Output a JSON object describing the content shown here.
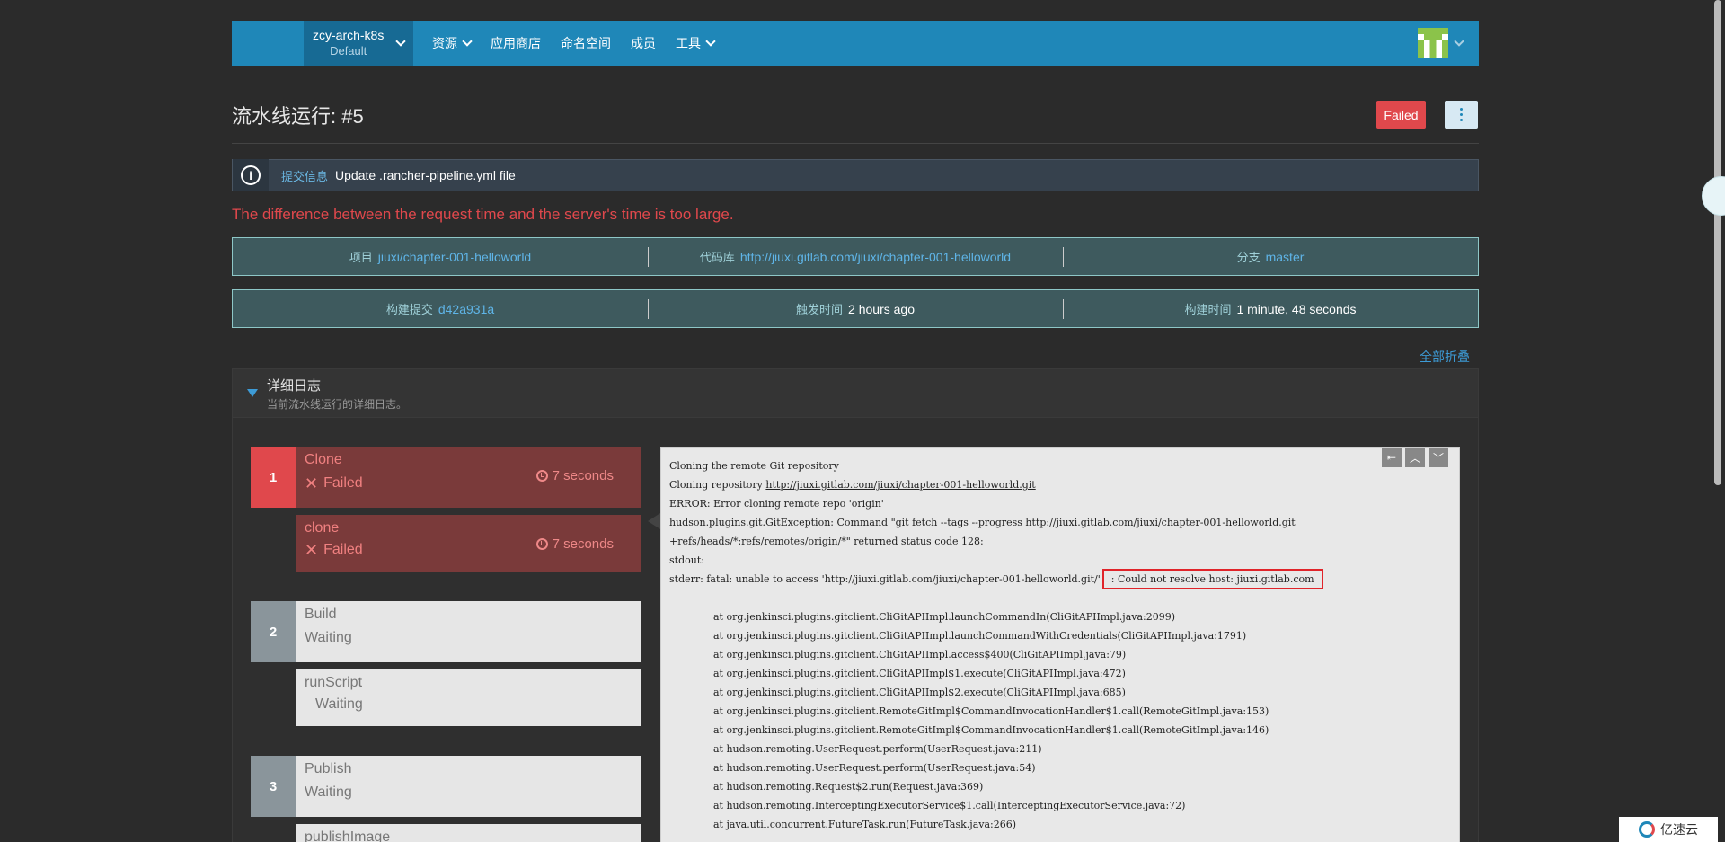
{
  "header": {
    "cluster_name": "zcy-arch-k8s",
    "cluster_sub": "Default",
    "nav": [
      {
        "label": "资源",
        "has_caret": true
      },
      {
        "label": "应用商店",
        "has_caret": false
      },
      {
        "label": "命名空间",
        "has_caret": false
      },
      {
        "label": "成员",
        "has_caret": false
      },
      {
        "label": "工具",
        "has_caret": true
      }
    ]
  },
  "page": {
    "title": "流水线运行: #5",
    "status_badge": "Failed"
  },
  "commit": {
    "label": "提交信息",
    "message": "Update .rancher-pipeline.yml file"
  },
  "error_message": "The difference between the request time and the server's time is too large.",
  "meta_row1": [
    {
      "label": "项目",
      "value": "jiuxi/chapter-001-helloworld",
      "link": true
    },
    {
      "label": "代码库",
      "value": "http://jiuxi.gitlab.com/jiuxi/chapter-001-helloworld",
      "link": true
    },
    {
      "label": "分支",
      "value": "master",
      "link": true
    }
  ],
  "meta_row2": [
    {
      "label": "构建提交",
      "value": "d42a931a",
      "link": true
    },
    {
      "label": "触发时间",
      "value": "2 hours ago",
      "link": false
    },
    {
      "label": "构建时间",
      "value": "1 minute, 48 seconds",
      "link": false
    }
  ],
  "collapse_all": "全部折叠",
  "log": {
    "title": "详细日志",
    "subtitle": "当前流水线运行的详细日志。"
  },
  "stages": [
    {
      "num": "1",
      "name": "Clone",
      "status": "Failed",
      "time": "7 seconds",
      "steps": [
        {
          "name": "clone",
          "status": "Failed",
          "time": "7 seconds"
        }
      ]
    },
    {
      "num": "2",
      "name": "Build",
      "status": "Waiting",
      "steps": [
        {
          "name": "runScript",
          "status": "Waiting"
        }
      ]
    },
    {
      "num": "3",
      "name": "Publish",
      "status": "Waiting",
      "steps": [
        {
          "name": "publishImage",
          "status": ""
        }
      ]
    }
  ],
  "console": {
    "lines": [
      "Cloning the remote Git repository",
      "Cloning repository http://jiuxi.gitlab.com/jiuxi/chapter-001-helloworld.git",
      "ERROR: Error cloning remote repo 'origin'",
      "hudson.plugins.git.GitException: Command \"git fetch --tags --progress http://jiuxi.gitlab.com/jiuxi/chapter-001-helloworld.git",
      "+refs/heads/*:refs/remotes/origin/*\" returned status code 128:",
      "stdout:",
      "stderr: fatal: unable to access 'http://jiuxi.gitlab.com/jiuxi/chapter-001-helloworld.git/'",
      ": Could not resolve host: jiuxi.gitlab.com",
      "",
      "at org.jenkinsci.plugins.gitclient.CliGitAPIImpl.launchCommandIn(CliGitAPIImpl.java:2099)",
      "at org.jenkinsci.plugins.gitclient.CliGitAPIImpl.launchCommandWithCredentials(CliGitAPIImpl.java:1791)",
      "at org.jenkinsci.plugins.gitclient.CliGitAPIImpl.access$400(CliGitAPIImpl.java:79)",
      "at org.jenkinsci.plugins.gitclient.CliGitAPIImpl$1.execute(CliGitAPIImpl.java:472)",
      "at org.jenkinsci.plugins.gitclient.CliGitAPIImpl$2.execute(CliGitAPIImpl.java:685)",
      "at org.jenkinsci.plugins.gitclient.RemoteGitImpl$CommandInvocationHandler$1.call(RemoteGitImpl.java:153)",
      "at org.jenkinsci.plugins.gitclient.RemoteGitImpl$CommandInvocationHandler$1.call(RemoteGitImpl.java:146)",
      "at hudson.remoting.UserRequest.perform(UserRequest.java:211)",
      "at hudson.remoting.UserRequest.perform(UserRequest.java:54)",
      "at hudson.remoting.Request$2.run(Request.java:369)",
      "at hudson.remoting.InterceptingExecutorService$1.call(InterceptingExecutorService.java:72)",
      "at java.util.concurrent.FutureTask.run(FutureTask.java:266)"
    ]
  },
  "watermark": "亿速云"
}
